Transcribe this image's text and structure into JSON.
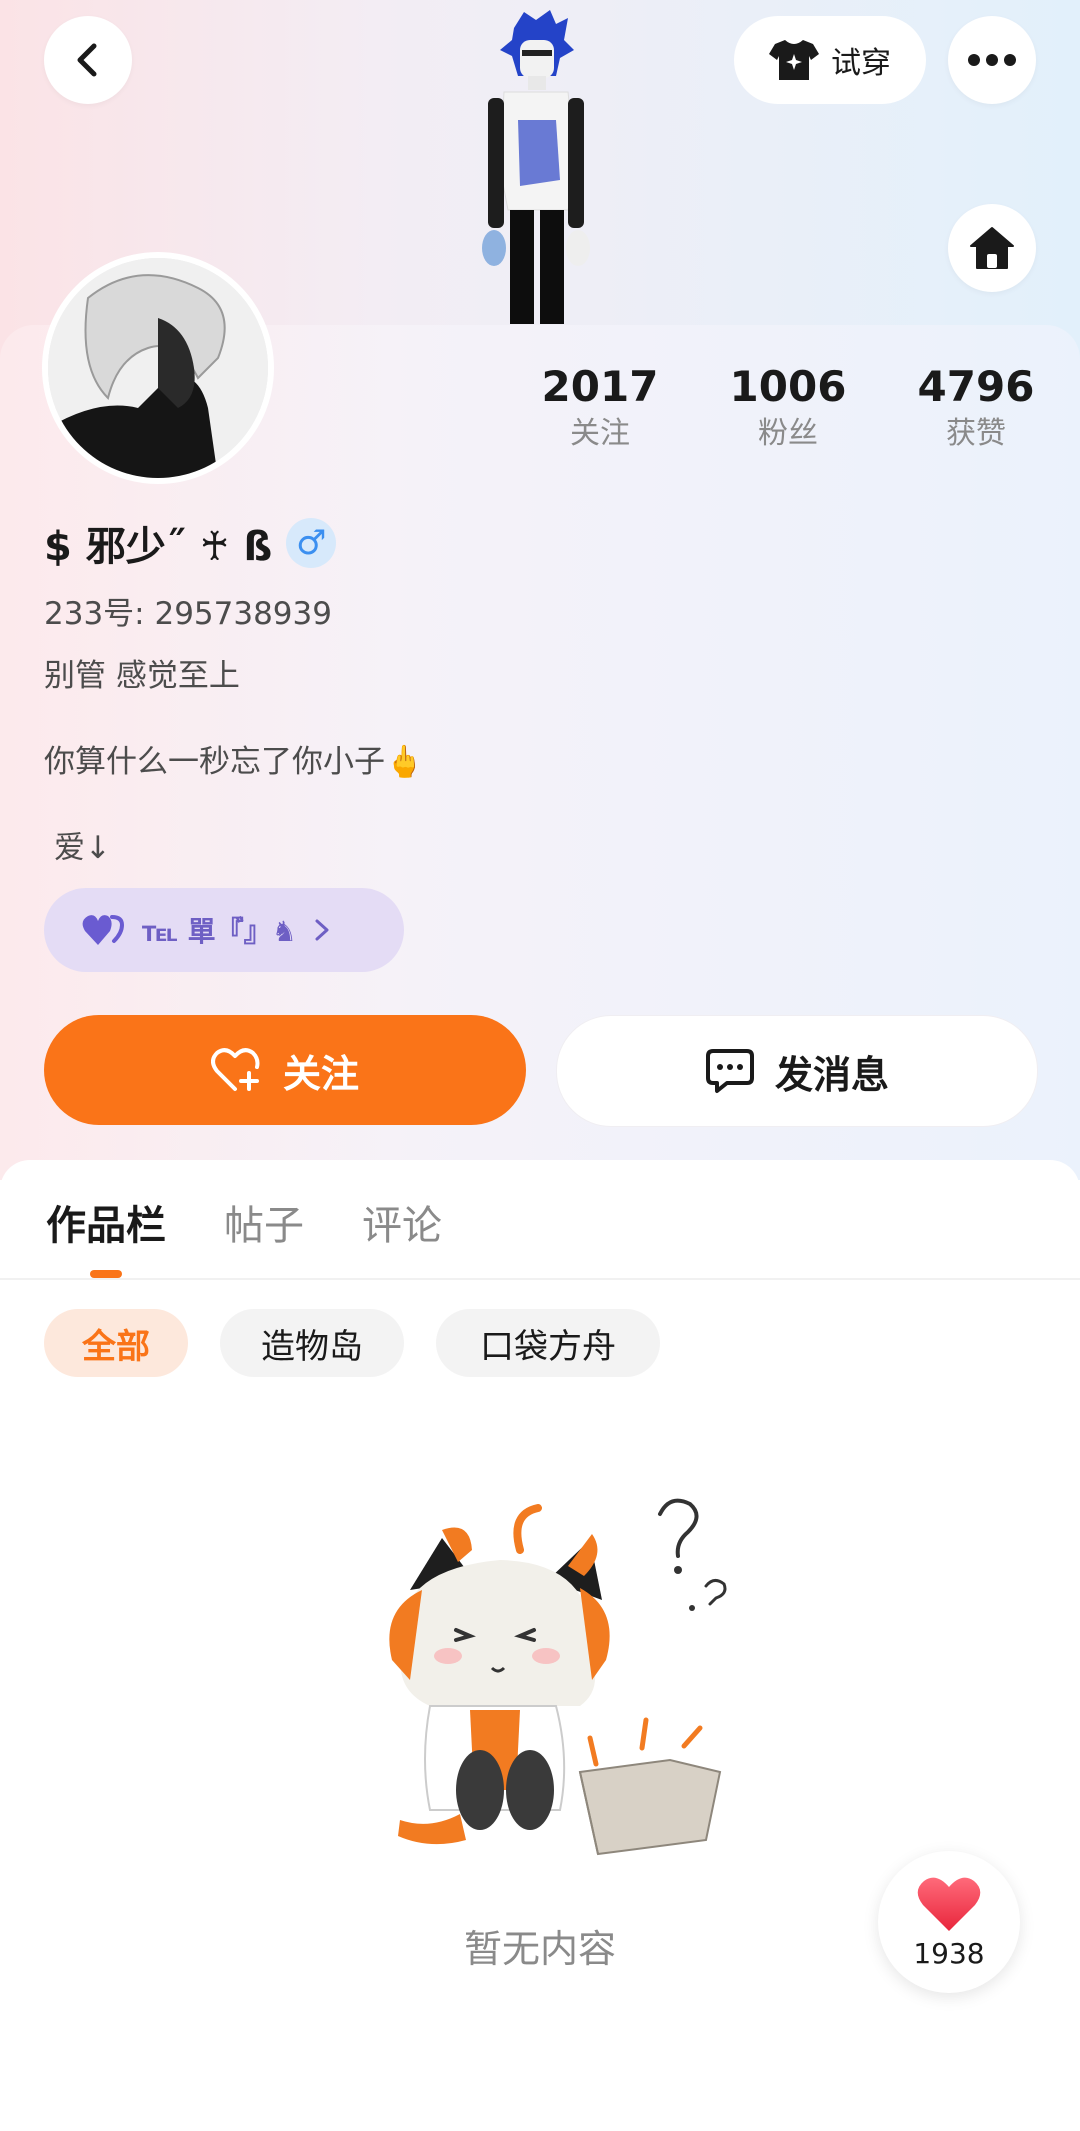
{
  "header": {
    "try_on_label": "试穿"
  },
  "stats": [
    {
      "value": "2017",
      "label": "关注"
    },
    {
      "value": "1006",
      "label": "粉丝"
    },
    {
      "value": "4796",
      "label": "获赞"
    }
  ],
  "profile": {
    "name": "$ 邪少˝ ♰ ß",
    "gender_symbol": "♂",
    "id_line": "233号: 295738939",
    "bio_line1": "别管 感觉至上",
    "bio_line2": "你算什么一秒忘了你小子🖕",
    "bio_line3": "爱↓",
    "tag_text": "℡ 單『゙』♞"
  },
  "actions": {
    "follow_label": "关注",
    "message_label": "发消息"
  },
  "tabs": [
    {
      "label": "作品栏",
      "active": true
    },
    {
      "label": "帖子",
      "active": false
    },
    {
      "label": "评论",
      "active": false
    }
  ],
  "chips": [
    {
      "label": "全部",
      "active": true
    },
    {
      "label": "造物岛",
      "active": false
    },
    {
      "label": "口袋方舟",
      "active": false
    }
  ],
  "empty_state": {
    "text": "暂无内容"
  },
  "like_float": {
    "count": "1938"
  },
  "colors": {
    "accent": "#fa7418",
    "tag_bg": "#e4dcf5",
    "gender": "#3b8ff0"
  }
}
